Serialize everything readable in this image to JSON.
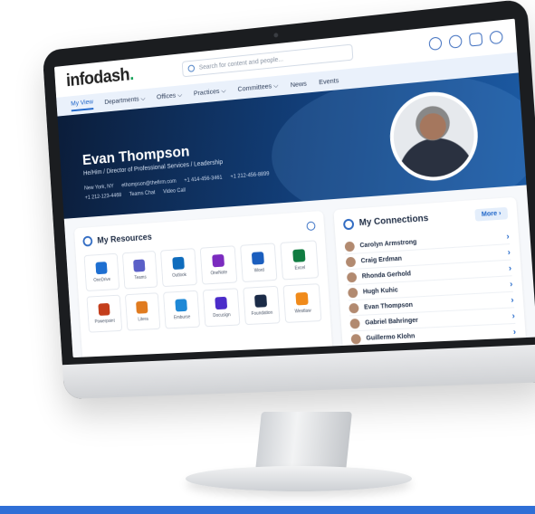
{
  "brand": {
    "name": "infodash",
    "dot": ".",
    "accent": "#1aa35b"
  },
  "search": {
    "placeholder": "Search for content and people..."
  },
  "nav": {
    "items": [
      {
        "label": "My View",
        "active": true
      },
      {
        "label": "Departments ⌵"
      },
      {
        "label": "Offices ⌵"
      },
      {
        "label": "Practices ⌵"
      },
      {
        "label": "Committees ⌵"
      },
      {
        "label": "News"
      },
      {
        "label": "Events"
      }
    ]
  },
  "profile": {
    "name": "Evan Thompson",
    "title": "He/Him  /  Director of Professional Services  /  Leadership",
    "location": "New York, NY",
    "email": "ethompson@thefirm.com",
    "phone1": "+1 414-456-3461",
    "phone2": "+1 212-456-8899",
    "phone3": "+1 212-123-4468",
    "teams_chat": "Teams Chat",
    "video_call": "Video Call"
  },
  "resources": {
    "title": "My Resources",
    "tiles": [
      {
        "label": "OneDrive",
        "color": "#1e6fd1"
      },
      {
        "label": "Teams",
        "color": "#5a5fc7"
      },
      {
        "label": "Outlook",
        "color": "#0f6cbd"
      },
      {
        "label": "OneNote",
        "color": "#7b2bbf"
      },
      {
        "label": "Word",
        "color": "#1b5ebe"
      },
      {
        "label": "Excel",
        "color": "#107c41"
      },
      {
        "label": "Powerpoint",
        "color": "#c43e1c"
      },
      {
        "label": "Litera",
        "color": "#e07b1f"
      },
      {
        "label": "Emburse",
        "color": "#1e88d6"
      },
      {
        "label": "Docusign",
        "color": "#4b2cc9"
      },
      {
        "label": "Foundation",
        "color": "#1b2b47"
      },
      {
        "label": "Westlaw",
        "color": "#f08a1a"
      }
    ]
  },
  "connections": {
    "title": "My Connections",
    "more_label": "More",
    "people": [
      "Carolyn Armstrong",
      "Craig Erdman",
      "Rhonda Gerhold",
      "Hugh Kuhic",
      "Evan Thompson",
      "Gabriel Bahringer",
      "Guillermo Klohn"
    ]
  },
  "colors": {
    "hero_dark": "#0b1d3a",
    "accent_blue": "#1f66c9",
    "bottom_bar": "#2f6fd6"
  }
}
